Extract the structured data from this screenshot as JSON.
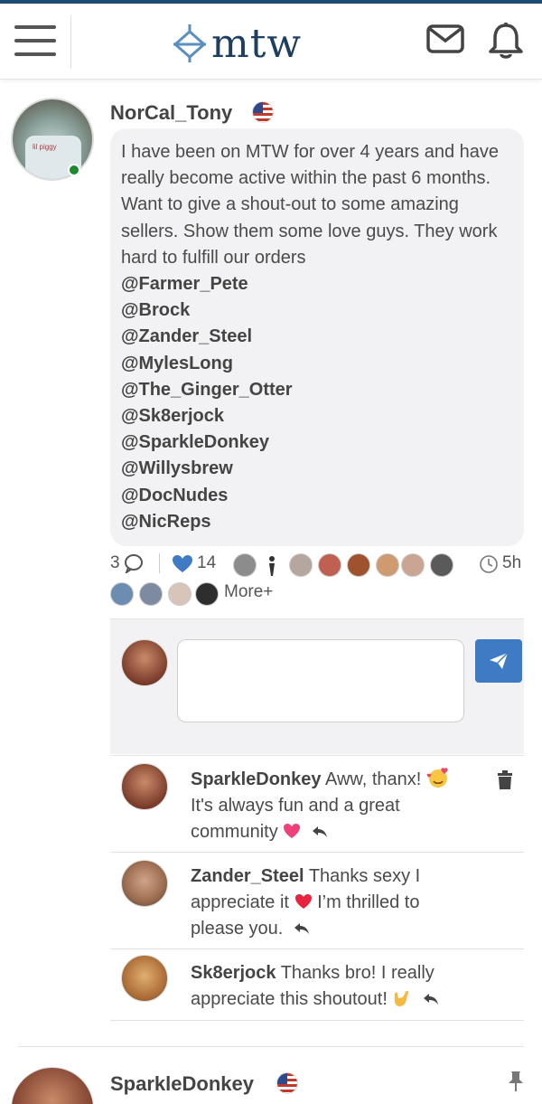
{
  "header": {
    "logo_text": "mtw",
    "menu_icon": "hamburger-menu-icon",
    "mail_icon": "envelope-icon",
    "bell_icon": "bell-icon",
    "brand_color": "#1e3f62"
  },
  "post": {
    "username": "NorCal_Tony",
    "flag_icon": "us-flag-icon",
    "avatar_shirt_text": "lil piggy",
    "body_text": "I have been on MTW for over 4 years and have really become active within the past 6 months. Want to give a shout-out to some amazing sellers. Show them some love guys. They work hard to fulfill our orders",
    "mentions": [
      "@Farmer_Pete",
      "@Brock",
      "@Zander_Steel",
      "@MylesLong",
      "@The_Ginger_Otter",
      "@Sk8erjock",
      "@SparkleDonkey",
      "@Willysbrew",
      "@DocNudes",
      "@NicReps"
    ],
    "comment_count": "3",
    "like_count": "14",
    "time_ago": "5h",
    "more_label": "More+"
  },
  "comments": [
    {
      "user": "SparkleDonkey",
      "text_lines": [
        "Aww, thanx!",
        "It's always fun and a great",
        "community"
      ]
    },
    {
      "user": "Zander_Steel",
      "text_lines": [
        "Thanks sexy I",
        "appreciate it",
        "I’m thrilled to",
        "please you."
      ]
    },
    {
      "user": "Sk8erjock",
      "text_lines": [
        "Thanks bro! I really",
        "appreciate this shoutout!"
      ]
    }
  ],
  "next_post": {
    "username": "SparkleDonkey"
  }
}
